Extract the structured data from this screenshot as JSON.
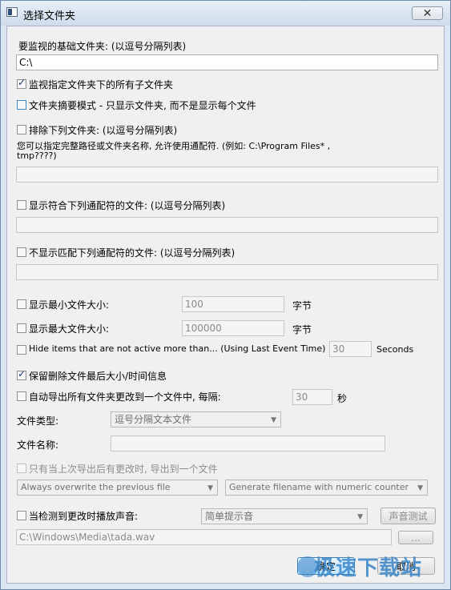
{
  "window": {
    "title": "选择文件夹",
    "close_glyph": "✕"
  },
  "base_folders": {
    "label": "要监视的基础文件夹: (以逗号分隔列表)",
    "value": "C:\\"
  },
  "watch_subfolders": {
    "label": "监视指定文件夹下的所有子文件夹",
    "checked": true
  },
  "summary_mode": {
    "label": "文件夹摘要模式 - 只显示文件夹, 而不是显示每个文件",
    "checked": false
  },
  "exclude_folders": {
    "label": "排除下列文件夹: (以逗号分隔列表)",
    "help_line1": "您可以指定完整路径或文件夹名称, 允许使用通配符. (例如: C:\\Program Files* ,",
    "help_line2": "tmp????)",
    "value": ""
  },
  "show_matching": {
    "label": "显示符合下列通配符的文件: (以逗号分隔列表)",
    "value": ""
  },
  "hide_matching": {
    "label": "不显示匹配下列通配符的文件: (以逗号分隔列表)",
    "value": ""
  },
  "min_size": {
    "label": "显示最小文件大小:",
    "value": "100",
    "unit": "字节"
  },
  "max_size": {
    "label": "显示最大文件大小:",
    "value": "100000",
    "unit": "字节"
  },
  "hide_inactive": {
    "label": "Hide items that are not active more than... (Using Last Event Time)",
    "value": "30",
    "unit": "Seconds"
  },
  "keep_deleted": {
    "label": "保留删除文件最后大小/时间信息",
    "checked": true
  },
  "auto_export": {
    "label": "自动导出所有文件夹更改到一个文件中, 每隔:",
    "value": "30",
    "unit": "秒"
  },
  "file_type": {
    "label": "文件类型:",
    "value": "逗号分隔文本文件"
  },
  "file_name": {
    "label": "文件名称:",
    "value": ""
  },
  "export_only_changed": {
    "label": "只有当上次导出后有更改时, 导出到一个文件"
  },
  "overwrite_mode": {
    "value": "Always overwrite the previous file"
  },
  "filename_mode": {
    "value": "Generate filename with numeric counter"
  },
  "play_sound": {
    "label": "当检测到更改时播放声音:",
    "value": "简单提示音",
    "test_label": "声音测试"
  },
  "sound_file": {
    "value": "C:\\Windows\\Media\\tada.wav",
    "browse_label": "..."
  },
  "buttons": {
    "ok": "确定",
    "cancel": "取消"
  },
  "watermark": "极速下载站"
}
